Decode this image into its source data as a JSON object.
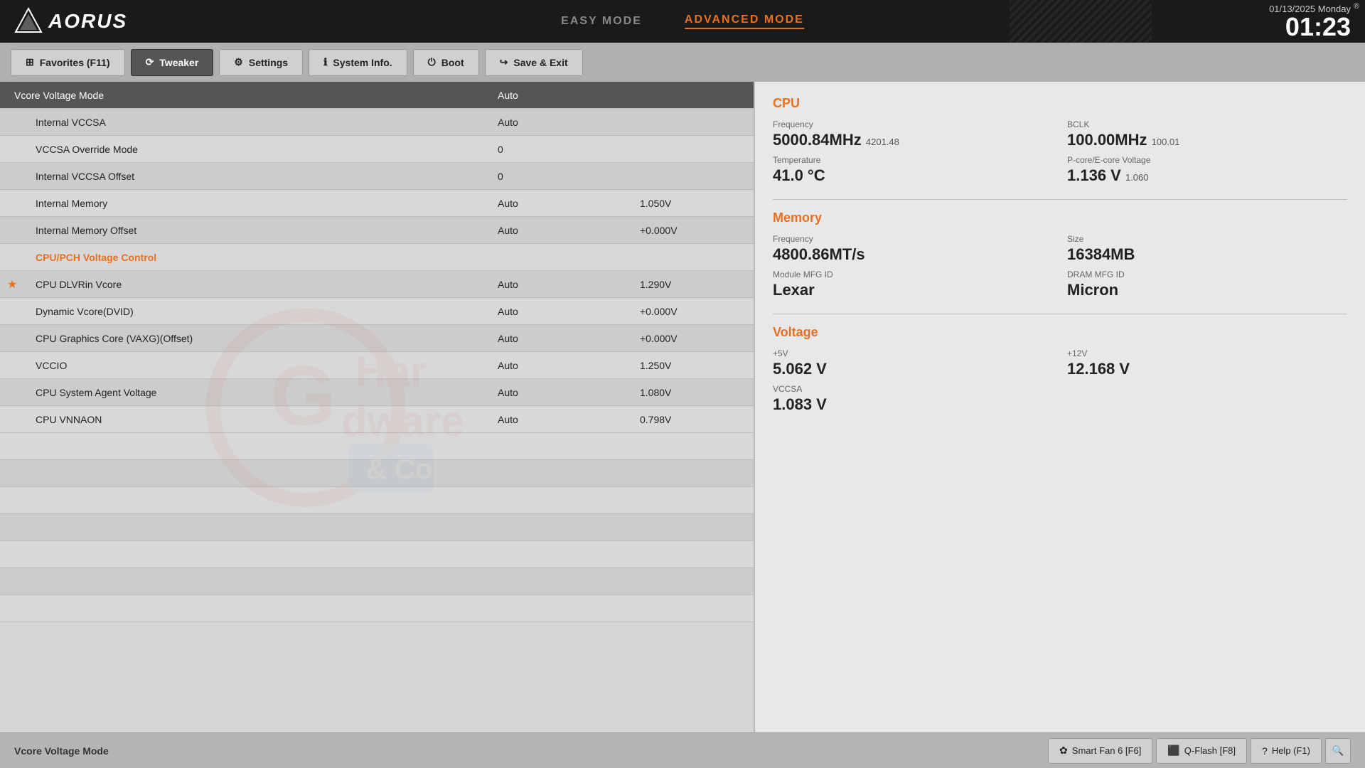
{
  "header": {
    "logo": "AORUS",
    "easy_mode": "EASY MODE",
    "advanced_mode": "ADVANCED MODE",
    "date": "01/13/2025 Monday",
    "time": "01:23",
    "reg_symbol": "®"
  },
  "nav": {
    "favorites": "Favorites (F11)",
    "tweaker": "Tweaker",
    "settings": "Settings",
    "system_info": "System Info.",
    "boot": "Boot",
    "save_exit": "Save & Exit"
  },
  "settings": {
    "rows": [
      {
        "name": "Vcore Voltage Mode",
        "value": "Auto",
        "value2": "",
        "star": false,
        "indent": true,
        "orange": false,
        "header": true
      },
      {
        "name": "Internal VCCSA",
        "value": "Auto",
        "value2": "",
        "star": false,
        "indent": true,
        "orange": false
      },
      {
        "name": "VCCSA Override Mode",
        "value": "0",
        "value2": "",
        "star": false,
        "indent": true,
        "orange": false
      },
      {
        "name": "Internal VCCSA Offset",
        "value": "0",
        "value2": "",
        "star": false,
        "indent": true,
        "orange": false
      },
      {
        "name": "Internal Memory",
        "value": "Auto",
        "value2": "1.050V",
        "star": false,
        "indent": true,
        "orange": false
      },
      {
        "name": "Internal Memory Offset",
        "value": "Auto",
        "value2": "+0.000V",
        "star": false,
        "indent": true,
        "orange": false
      },
      {
        "name": "CPU/PCH Voltage Control",
        "value": "",
        "value2": "",
        "star": false,
        "indent": true,
        "orange": true,
        "section": true
      },
      {
        "name": "CPU DLVRin Vcore",
        "value": "Auto",
        "value2": "1.290V",
        "star": true,
        "indent": true,
        "orange": false
      },
      {
        "name": "Dynamic Vcore(DVID)",
        "value": "Auto",
        "value2": "+0.000V",
        "star": false,
        "indent": true,
        "orange": false
      },
      {
        "name": "CPU Graphics Core (VAXG)(Offset)",
        "value": "Auto",
        "value2": "+0.000V",
        "star": false,
        "indent": true,
        "orange": false
      },
      {
        "name": "VCCIO",
        "value": "Auto",
        "value2": "1.250V",
        "star": false,
        "indent": true,
        "orange": false
      },
      {
        "name": "CPU System Agent Voltage",
        "value": "Auto",
        "value2": "1.080V",
        "star": false,
        "indent": true,
        "orange": false
      },
      {
        "name": "CPU VNNAON",
        "value": "Auto",
        "value2": "0.798V",
        "star": false,
        "indent": true,
        "orange": false
      }
    ]
  },
  "cpu": {
    "title": "CPU",
    "freq_label": "Frequency",
    "freq_value": "5000.84MHz",
    "freq_suffix": "4201.48",
    "bclk_label": "BCLK",
    "bclk_value": "100.00MHz",
    "bclk_suffix": "100.01",
    "temp_label": "Temperature",
    "temp_value": "41.0 °C",
    "pcore_label": "P-core/E-core Voltage",
    "pcore_value": "1.136 V",
    "pcore_suffix": "1.060"
  },
  "memory": {
    "title": "Memory",
    "freq_label": "Frequency",
    "freq_value": "4800.86MT/s",
    "size_label": "Size",
    "size_value": "16384MB",
    "mfg_label": "Module MFG ID",
    "mfg_value": "Lexar",
    "dram_label": "DRAM MFG ID",
    "dram_value": "Micron"
  },
  "voltage": {
    "title": "Voltage",
    "v5_label": "+5V",
    "v5_value": "5.062 V",
    "v12_label": "+12V",
    "v12_value": "12.168 V",
    "vccsa_label": "VCCSA",
    "vccsa_value": "1.083 V"
  },
  "bottom": {
    "hint": "Vcore Voltage Mode",
    "smart_fan": "Smart Fan 6 [F6]",
    "qflash": "Q-Flash [F8]",
    "help": "Help (F1)"
  }
}
